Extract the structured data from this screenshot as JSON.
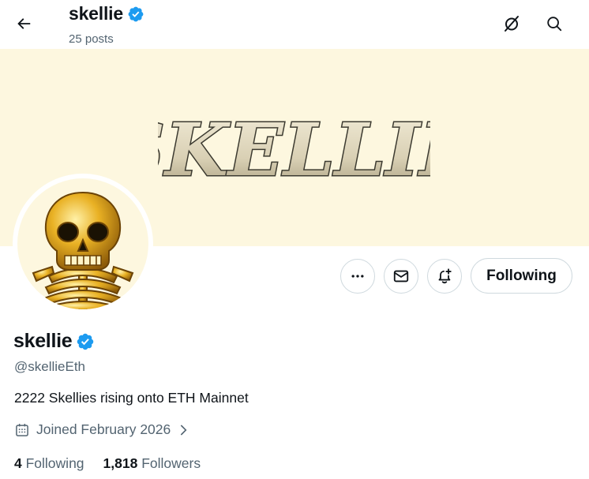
{
  "header": {
    "title": "skellie",
    "posts_count": "25 posts",
    "icons": [
      "back-arrow-icon",
      "verified-badge-icon",
      "grok-icon",
      "search-icon"
    ]
  },
  "banner": {
    "logo_text": "SKELLIE",
    "background": "#fdf7df"
  },
  "actions": {
    "more_icon": "more-dots-icon",
    "message_icon": "mail-icon",
    "notify_icon": "bell-plus-icon",
    "follow_label": "Following"
  },
  "profile": {
    "display_name": "skellie",
    "handle": "@skellieEth",
    "bio": "2222 Skellies rising onto ETH Mainnet",
    "joined": "Joined February 2026",
    "following_count": "4",
    "following_label": "Following",
    "followers_count": "1,818",
    "followers_label": "Followers"
  },
  "colors": {
    "verified": "#1d9bf0",
    "secondary_text": "#536471",
    "border": "#cfd9de"
  }
}
